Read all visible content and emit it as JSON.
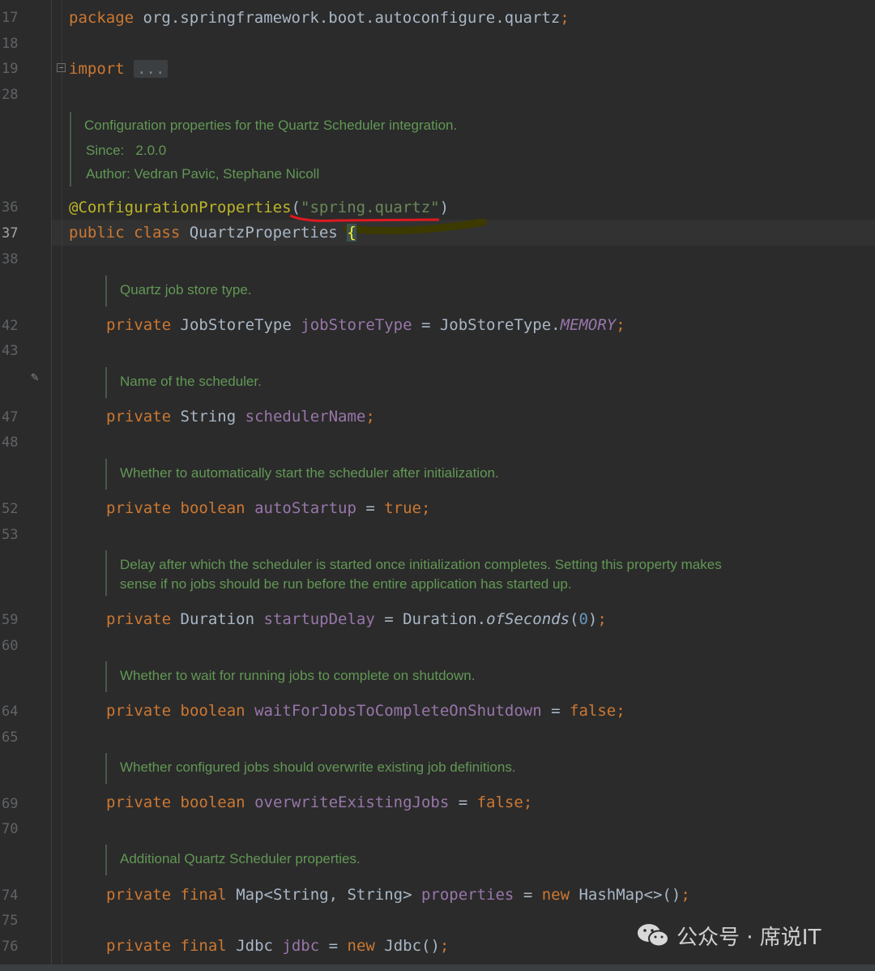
{
  "editor": {
    "line_numbers": [
      "17",
      "18",
      "19",
      "28",
      "36",
      "37",
      "38",
      "42",
      "43",
      "47",
      "48",
      "52",
      "53",
      "59",
      "60",
      "64",
      "65",
      "69",
      "70",
      "74",
      "75",
      "76"
    ],
    "active_line": "37",
    "code": {
      "package_kw": "package",
      "package_name": " org.springframework.boot.autoconfigure.quartz",
      "semicolon": ";",
      "import_kw": "import",
      "import_fold": "...",
      "annotation": "@ConfigurationProperties",
      "ann_open": "(",
      "ann_value": "\"spring.quartz\"",
      "ann_close": ")",
      "class_decl_kw": "public class",
      "class_name": " QuartzProperties ",
      "open_brace": "{",
      "private": "private",
      "final": "final",
      "new": "new",
      "f1_type": "JobStoreType",
      "f1_name": "jobStoreType",
      "f1_eq": " = JobStoreType.",
      "f1_val": "MEMORY",
      "f2_type": "String",
      "f2_name": "schedulerName",
      "f3_type": "boolean",
      "f3_name": "autoStartup",
      "f3_val": "true",
      "f4_type": "Duration",
      "f4_name": "startupDelay",
      "f4_eq": " = Duration.",
      "f4_method": "ofSeconds",
      "f4_num": "0",
      "f5_type": "boolean",
      "f5_name": "waitForJobsToCompleteOnShutdown",
      "f5_val": "false",
      "f6_type": "boolean",
      "f6_name": "overwriteExistingJobs",
      "f6_val": "false",
      "f7_type": "Map<String, String>",
      "f7_name": "properties",
      "f7_init": " HashMap<>()",
      "f8_type": "Jdbc",
      "f8_name": "jdbc",
      "f8_init": " Jdbc()",
      "eq": " = "
    },
    "docs": {
      "class_doc": "Configuration properties for the Quartz Scheduler integration.",
      "since_label": "Since:",
      "since_value": "2.0.0",
      "author": "Author: Vedran Pavic, Stephane Nicoll",
      "d1": "Quartz job store type.",
      "d2": "Name of the scheduler.",
      "d3": "Whether to automatically start the scheduler after initialization.",
      "d4a": "Delay after which the scheduler is started once initialization completes. Setting this property makes",
      "d4b": "sense if no jobs should be run before the entire application has started up.",
      "d5": "Whether to wait for running jobs to complete on shutdown.",
      "d6": "Whether configured jobs should overwrite existing job definitions.",
      "d7": "Additional Quartz Scheduler properties."
    }
  },
  "watermark": {
    "text": "公众号 · 席说IT"
  },
  "colors": {
    "background": "#2b2b2b",
    "keyword": "#cc7832",
    "annotation": "#bbb529",
    "string": "#6a8759",
    "field": "#9876aa",
    "doc": "#629755"
  }
}
